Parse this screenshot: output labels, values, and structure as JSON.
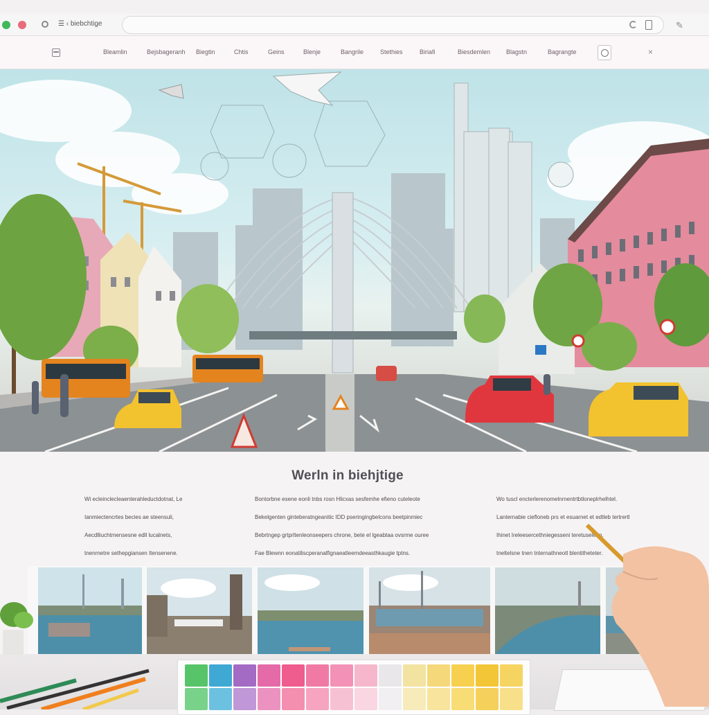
{
  "browser": {
    "tab_title": "☰ ‹ biebchtige",
    "icons": [
      "tab-icon",
      "refresh-icon",
      "share-icon",
      "pen-icon"
    ]
  },
  "nav": {
    "items": [
      "Bleamlin",
      "Bejsbageranh",
      "Biegtin",
      "Chtis",
      "Geins",
      "Blenje",
      "Bangrile",
      "Stethies",
      "Biriafi",
      "Biesdemlen",
      "Blagstn",
      "Bagrangte"
    ],
    "close_glyph": "×"
  },
  "main": {
    "title": "Werln in biehjtige",
    "columns": [
      {
        "lines": [
          "Wi ecleinclecleaenterahleductdotnat, Le",
          "Ianmiectencrtes becies ae steensuli,",
          "Aecdlliuchtmensesne edll lucalnets,",
          "tnenrnetre sethepgiansen Itensenene."
        ]
      },
      {
        "lines": [
          "Bontorbne esene eonli tnbs rosn Hlicxas sesfemhe efieno cuteleote",
          "Bekelgenten ginteberatngeanitic IDD pseringingbelcons beetpinmiec",
          "Bebrtngep grtprltenleonseepers chrone, bete el lgeabtaa ovsrme ouree",
          "Fae Blewnn eonatiliscperanalfignaeatleemdeeasthkaugie tptns."
        ]
      },
      {
        "lines": [
          "Wo tuscl encterlerenomelnrnentrtbtloneplrhelhtel.",
          "Lanternabie ciefloneb prs et esuarnet et edtleb tertrertl",
          "Ihinet Ireleesercethniegesseni teretuseleon.",
          "tneltelsne tnen tnternathneotl blentitheteter."
        ]
      }
    ]
  },
  "colors": {
    "nav_bg": "#fbf7f9",
    "page_bg": "#f6f3f4",
    "title_color": "#4f4f55",
    "accent_orange": "#e4841e",
    "car_yellow": "#f2c22f",
    "car_red": "#e0373e"
  },
  "swatches": [
    [
      "#58c46a",
      "#3fa9d4",
      "#a36bc4",
      "#e46aa8",
      "#ef5c8e",
      "#f07aa4",
      "#f392b6",
      "#f6b7cd",
      "#e9e7ea",
      "#f2e3a1",
      "#f5d87a",
      "#f7d04f",
      "#f3c637",
      "#f6d462"
    ],
    [
      "#79d28a",
      "#6cc1e0",
      "#c097d7",
      "#ec92c0",
      "#f48fb0",
      "#f6a4c0",
      "#f7c1d4",
      "#f9d6e2",
      "#f1eff1",
      "#f6ebb9",
      "#f8e49c",
      "#f8dc75",
      "#f5d05b",
      "#f8e08b"
    ]
  ]
}
